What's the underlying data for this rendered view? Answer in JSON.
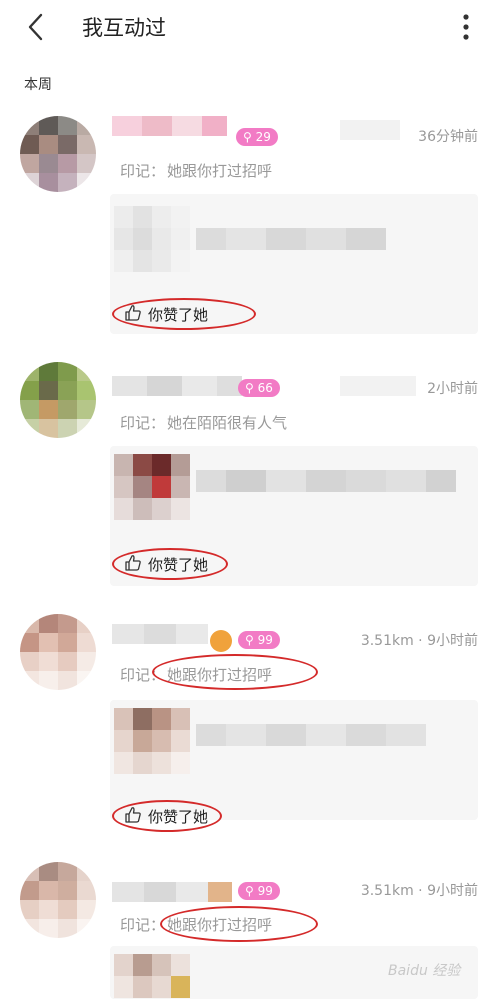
{
  "header": {
    "title": "我互动过"
  },
  "section_title": "本周",
  "stamp_prefix": "印记：",
  "items": [
    {
      "badge": "29",
      "time": "36分钟前",
      "stamp": "她跟你打过招呼",
      "like": "你赞了她"
    },
    {
      "badge": "66",
      "time": "2小时前",
      "stamp": "她在陌陌很有人气",
      "like": "你赞了她"
    },
    {
      "badge": "99",
      "time": "3.51km · 9小时前",
      "stamp": "她跟你打过招呼",
      "like": "你赞了她"
    },
    {
      "badge": "99",
      "time": "3.51km · 9小时前",
      "stamp": "她跟你打过招呼"
    }
  ],
  "watermark": "Baidu 经验",
  "colors": {
    "badge": "#f27bc5",
    "annotation": "#d42a2a",
    "muted": "#999999"
  }
}
